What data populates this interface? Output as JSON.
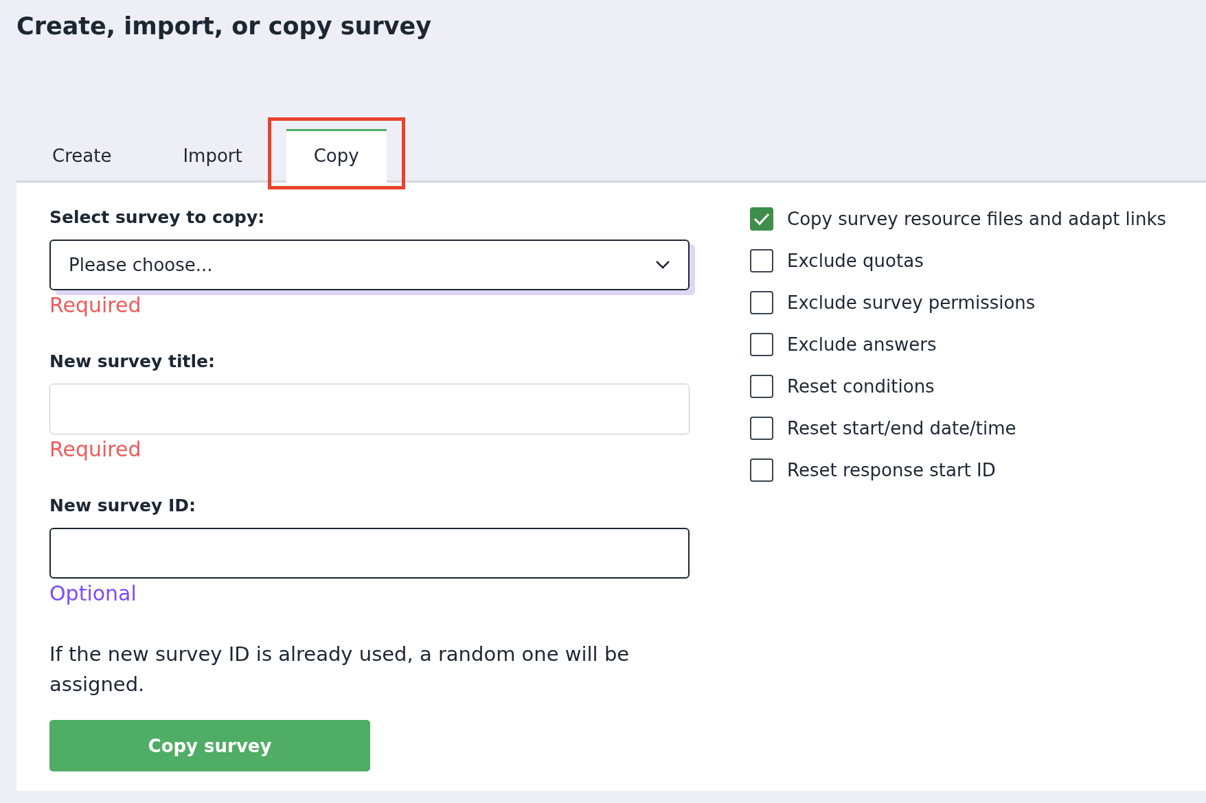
{
  "page_title": "Create, import, or copy survey",
  "tabs": [
    {
      "label": "Create",
      "selected": false,
      "highlighted": false
    },
    {
      "label": "Import",
      "selected": false,
      "highlighted": false
    },
    {
      "label": "Copy",
      "selected": true,
      "highlighted": true
    }
  ],
  "form": {
    "fields": [
      {
        "kind": "select",
        "label": "Select survey to copy:",
        "placeholder": "Please choose...",
        "focused": true,
        "hint": "Required",
        "required": true
      },
      {
        "kind": "text",
        "label": "New survey title:",
        "focused": false,
        "hint": "Required",
        "required": true
      },
      {
        "kind": "text",
        "label": "New survey ID:",
        "focused": true,
        "hint": "Optional",
        "required": false
      }
    ],
    "note": "If the new survey ID is already used, a random one will be assigned.",
    "submit": "Copy survey"
  },
  "options": [
    {
      "label": "Copy survey resource files and adapt links",
      "checked": true
    },
    {
      "label": "Exclude quotas",
      "checked": false
    },
    {
      "label": "Exclude survey permissions",
      "checked": false
    },
    {
      "label": "Exclude answers",
      "checked": false
    },
    {
      "label": "Reset conditions",
      "checked": false
    },
    {
      "label": "Reset start/end date/time",
      "checked": false
    },
    {
      "label": "Reset response start ID",
      "checked": false
    }
  ]
}
